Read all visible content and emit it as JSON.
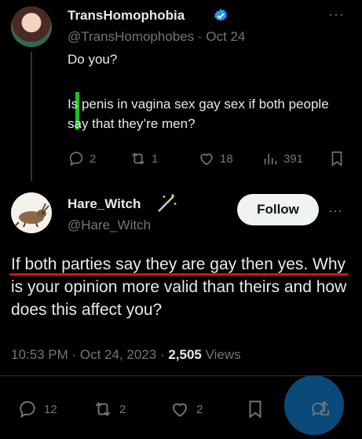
{
  "tweet1": {
    "display_name": "TransHomophobia",
    "handle_date": "@TransHomophobes · Oct 24",
    "text": "Do you?",
    "quote": "Is penis in vagina sex gay sex if both people say that they’re men?",
    "actions": {
      "replies": "2",
      "retweets": "1",
      "likes": "18",
      "views": "391"
    },
    "more": "···"
  },
  "tweet2": {
    "display_name": "Hare_Witch",
    "handle": "@Hare_Witch",
    "follow_label": "Follow",
    "more": "···",
    "body": "If both parties say they are gay then yes. Why is your opinion more valid than theirs and how does this affect you?",
    "time_date": "10:53 PM · Oct 24, 2023 · ",
    "views_count": "2,505",
    "views_label": " Views",
    "actions": {
      "replies": "12",
      "retweets": "2",
      "likes": "2"
    }
  },
  "colors": {
    "background": "#000000",
    "text": "#e7e9ea",
    "muted": "#71767b",
    "verified": "#1d9bf0",
    "quote_bar": "#1ec01e",
    "underline": "#e01010"
  }
}
